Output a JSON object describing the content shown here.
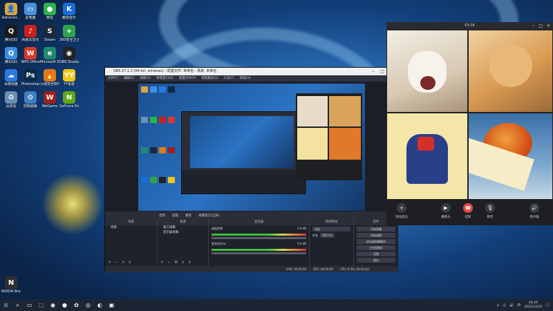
{
  "desktop": {
    "icons": [
      {
        "label": "Administ...",
        "glyph": "👤",
        "color": "#d9a441"
      },
      {
        "label": "腾讯QQ",
        "glyph": "Q",
        "color": "#1a1a1a"
      },
      {
        "label": "腾讯QQ",
        "glyph": "Q",
        "color": "#3b8fe0"
      },
      {
        "label": "百度网盘",
        "glyph": "☁",
        "color": "#2a7ae2"
      },
      {
        "label": "回收站",
        "glyph": "♻",
        "color": "#6b8fb3"
      },
      {
        "label": "此电脑",
        "glyph": "▭",
        "color": "#4a90d9"
      },
      {
        "label": "网易云音乐",
        "glyph": "♪",
        "color": "#c8201e"
      },
      {
        "label": "WPS Office",
        "glyph": "W",
        "color": "#d43b2b"
      },
      {
        "label": "Photoshop",
        "glyph": "Ps",
        "color": "#0b2a4a"
      },
      {
        "label": "控制面板",
        "glyph": "⚙",
        "color": "#3e7fc1"
      },
      {
        "label": "微信",
        "glyph": "●",
        "color": "#2bb24c"
      },
      {
        "label": "Steam",
        "glyph": "S",
        "color": "#1b2838"
      },
      {
        "label": "Microsoft Edge",
        "glyph": "e",
        "color": "#1f8a70"
      },
      {
        "label": "火绒安全软件",
        "glyph": "🔥",
        "color": "#e07a1e"
      },
      {
        "label": "WeGame",
        "glyph": "W",
        "color": "#a0201d"
      },
      {
        "label": "酷狗音乐",
        "glyph": "K",
        "color": "#1a6ed8"
      },
      {
        "label": "360安全卫士",
        "glyph": "+",
        "color": "#30a34a"
      },
      {
        "label": "OBS Studio",
        "glyph": "◉",
        "color": "#222"
      },
      {
        "label": "YY语音",
        "glyph": "YY",
        "color": "#f2c318"
      },
      {
        "label": "GeForce Experience",
        "glyph": "N",
        "color": "#5fa718"
      },
      {
        "label": "NVIDIA Broadcast",
        "glyph": "N",
        "color": "#2f2f2f"
      }
    ]
  },
  "obs": {
    "title": "OBS 27.1.3 (64-bit, windows) - 配置文件: 未命名 - 场景: 未命名",
    "menu": [
      "文件(F)",
      "编辑(E)",
      "视图(V)",
      "停靠窗口(D)",
      "配置文件(P)",
      "场景集合(S)",
      "工具(T)",
      "帮助(H)"
    ],
    "source_toolbar": [
      "音频",
      "滤镜",
      "属性",
      "采集窗口(全屏)"
    ],
    "docks": {
      "scenes_header": "场景",
      "scenes": [
        "场景"
      ],
      "sources_header": "来源",
      "sources": [
        "窗口采集",
        "显示器采集"
      ],
      "mixer_header": "混音器",
      "mixer": [
        {
          "name": "桌面音频",
          "level": "0.0 dB"
        },
        {
          "name": "麦克风/Aux",
          "level": "0.0 dB"
        }
      ],
      "transition_header": "转场特效",
      "transition_type": "淡出",
      "duration_label": "时长",
      "duration_value": "300 ms",
      "controls_header": "控件",
      "controls": [
        "开始直播",
        "开始录制",
        "启动虚拟摄像机",
        "工作室模式",
        "设置",
        "退出"
      ]
    },
    "status": {
      "live": "LIVE: 00:00:00",
      "rec": "REC: 00:00:00",
      "cpu": "CPU: 6.4%, 60.00 fps"
    }
  },
  "call": {
    "timer": "03:18",
    "buttons": [
      {
        "label": "添加成员",
        "glyph": "+"
      },
      {
        "label": "摄像头",
        "glyph": "▶"
      },
      {
        "label": "挂断",
        "glyph": "☎"
      },
      {
        "label": "静音",
        "glyph": "🎙"
      },
      {
        "label": "扬声器",
        "glyph": "🔊"
      }
    ]
  },
  "taskbar": {
    "time": "20:29",
    "date": "2021/12/24",
    "apps": [
      "⊞",
      "⌕",
      "▭",
      "⬚",
      "◉",
      "●",
      "✿",
      "◎",
      "◐",
      "▣"
    ]
  }
}
